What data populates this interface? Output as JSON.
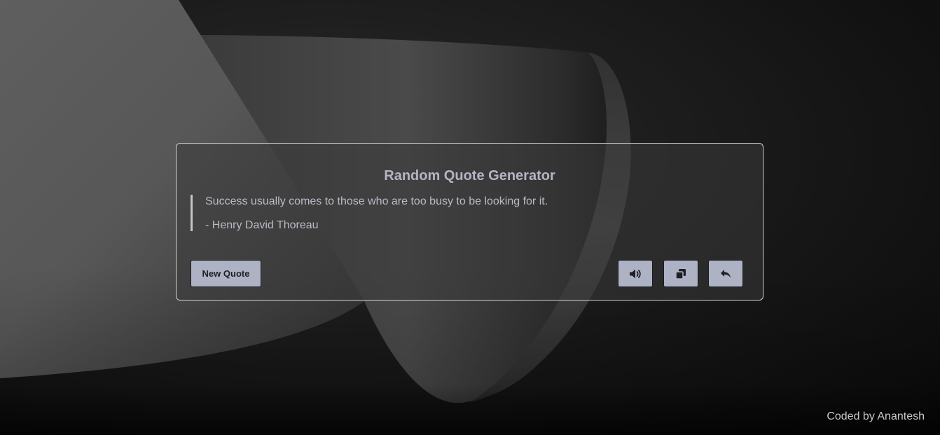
{
  "app": {
    "title": "Random Quote Generator"
  },
  "quote": {
    "text": "Success usually comes to those who are too busy to be looking for it.",
    "author": "- Henry David Thoreau"
  },
  "actions": {
    "new_quote_label": "New Quote",
    "speak_icon": "speaker-icon",
    "copy_icon": "copy-icon",
    "share_icon": "share-reply-icon"
  },
  "footer": {
    "credit": "Coded by Anantesh"
  },
  "colors": {
    "background": "#121212",
    "card_border": "#cfcfcf",
    "button_bg": "#adb3c4",
    "title_text": "#b3b6c2",
    "quote_bar": "#c9c0c8"
  }
}
